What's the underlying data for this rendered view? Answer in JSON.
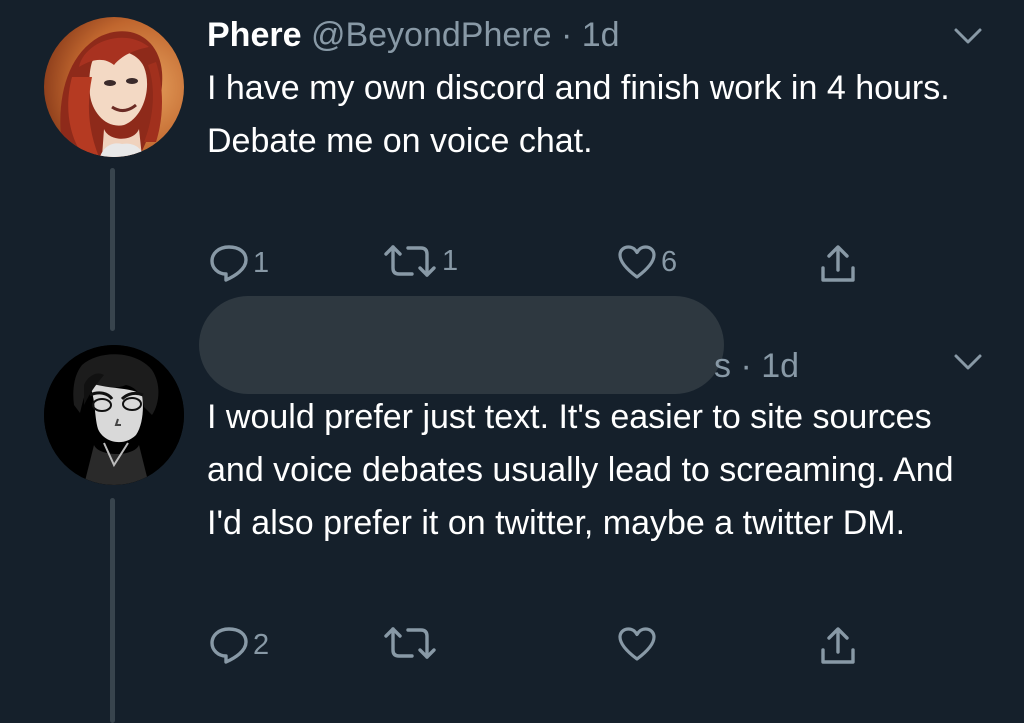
{
  "tweets": [
    {
      "display_name": "Phere",
      "handle": "@BeyondPhere",
      "time": "· 1d",
      "text_lines": [
        "I have my own discord and finish work in 4 hours.",
        "Debate me on voice chat."
      ],
      "replies": "1",
      "retweets": "1",
      "likes": "6"
    },
    {
      "display_name": "",
      "handle": "s",
      "time": "· 1d",
      "text": "I would prefer just text. It's easier to site sources and voice debates usually lead to screaming. And I'd also prefer it on twitter, maybe a twitter DM.",
      "replies": "2",
      "retweets": "",
      "likes": ""
    }
  ],
  "icons": {
    "reply": "reply-icon",
    "retweet": "retweet-icon",
    "like": "heart-icon",
    "share": "share-icon",
    "more": "chevron-down-icon"
  },
  "colors": {
    "background": "#15202b",
    "text": "#ffffff",
    "muted": "#8899a6",
    "thread_line": "#38444d",
    "redaction": "#2e3840"
  }
}
